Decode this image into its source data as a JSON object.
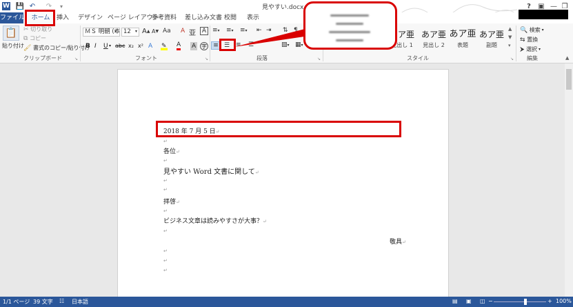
{
  "window": {
    "doc_title": "見やすい.docx - V",
    "help": "?",
    "minimize": "—",
    "restore": "❐"
  },
  "quick_access": {
    "word_icon": "W",
    "save_icon": "floppy-icon",
    "undo_icon": "undo-icon",
    "redo_icon": "redo-icon"
  },
  "tabs": [
    "ファイル",
    "ホーム",
    "挿入",
    "デザイン",
    "ページ レイアウト",
    "参考資料",
    "差し込み文書",
    "校閲",
    "表示"
  ],
  "clipboard": {
    "paste": "貼り付け",
    "cut": "切り取り",
    "copy": "コピー",
    "format_painter": "書式のコピー/貼り付け",
    "label": "クリップボード"
  },
  "font": {
    "name": "ＭＳ 明朝 (本",
    "size": "12",
    "grow": "A",
    "shrink": "A",
    "case": "Aa",
    "clear": "A",
    "bold": "B",
    "italic": "I",
    "underline": "U",
    "strike": "abc",
    "subscript": "x₂",
    "superscript": "x²",
    "label": "フォント"
  },
  "paragraph": {
    "label": "段落"
  },
  "styles": {
    "items": [
      {
        "preview": "あア亜",
        "name": "見出し 1"
      },
      {
        "preview": "あア亜",
        "name": "見出し 2"
      },
      {
        "preview": "あア亜",
        "name": "表題"
      },
      {
        "preview": "あア亜",
        "name": "副題"
      }
    ],
    "label": "スタイル"
  },
  "editing": {
    "find": "検索",
    "replace": "置換",
    "select": "選択",
    "label": "編集"
  },
  "document": {
    "lines": [
      "2018 年 7 月 5 日",
      "各位",
      "見やすい Word 文書に関して",
      "拝啓",
      "ビジネス文章は読みやすさが大事？",
      "敬具"
    ],
    "paragraph_mark": "↵"
  },
  "status": {
    "page": "1/1 ページ",
    "words": "39 文字",
    "language": "日本語",
    "zoom": "100%",
    "zoom_minus": "−",
    "zoom_plus": "+"
  },
  "annotation_color": "#d90000",
  "accent": "#2b579a"
}
